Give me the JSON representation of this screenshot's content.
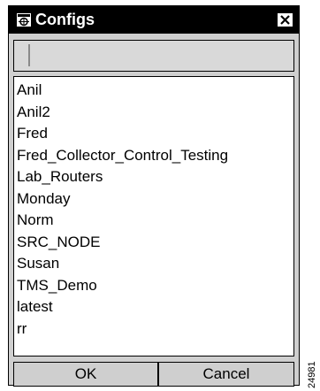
{
  "window": {
    "title": "Configs",
    "icon": "window-icon",
    "close_icon": "close-icon"
  },
  "search": {
    "value": "",
    "placeholder": ""
  },
  "configs": {
    "items": [
      {
        "label": "Anil"
      },
      {
        "label": "Anil2"
      },
      {
        "label": "Fred"
      },
      {
        "label": "Fred_Collector_Control_Testing"
      },
      {
        "label": "Lab_Routers"
      },
      {
        "label": "Monday"
      },
      {
        "label": "Norm"
      },
      {
        "label": "SRC_NODE"
      },
      {
        "label": "Susan"
      },
      {
        "label": "TMS_Demo"
      },
      {
        "label": "latest"
      },
      {
        "label": "rr"
      }
    ]
  },
  "buttons": {
    "ok_label": "OK",
    "cancel_label": "Cancel"
  },
  "figure_id": "24981"
}
